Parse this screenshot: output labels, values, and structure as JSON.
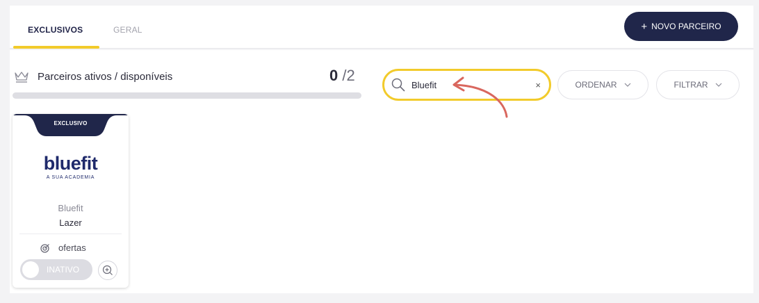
{
  "tabs": {
    "exclusive": "EXCLUSIVOS",
    "general": "GERAL"
  },
  "header": {
    "new_partner_plus": "+",
    "new_partner_label": "NOVO PARCEIRO"
  },
  "section": {
    "title": "Parceiros ativos / disponíveis",
    "active_count": "0",
    "available_total": "/2",
    "progress_fraction": 0
  },
  "search": {
    "value": "Bluefit",
    "clear": "×"
  },
  "controls": {
    "sort_label": "ORDENAR",
    "filter_label": "FILTRAR"
  },
  "cards": [
    {
      "badge": "EXCLUSIVO",
      "logo_text": "bluefit",
      "logo_tagline": "A SUA ACADEMIA",
      "name": "Bluefit",
      "category": "Lazer",
      "offers_label": "ofertas",
      "status_label": "INATIVO"
    }
  ],
  "colors": {
    "accent_yellow": "#f2cb2b",
    "navy": "#20264a",
    "annotation_red": "#d9675e",
    "logo_blue": "#1f2a6b"
  },
  "icons": {
    "crown": "crown-icon",
    "search": "search-icon",
    "clear": "close-icon",
    "chevron": "chevron-down-icon",
    "offers": "target-icon",
    "add": "add-offer-icon"
  }
}
